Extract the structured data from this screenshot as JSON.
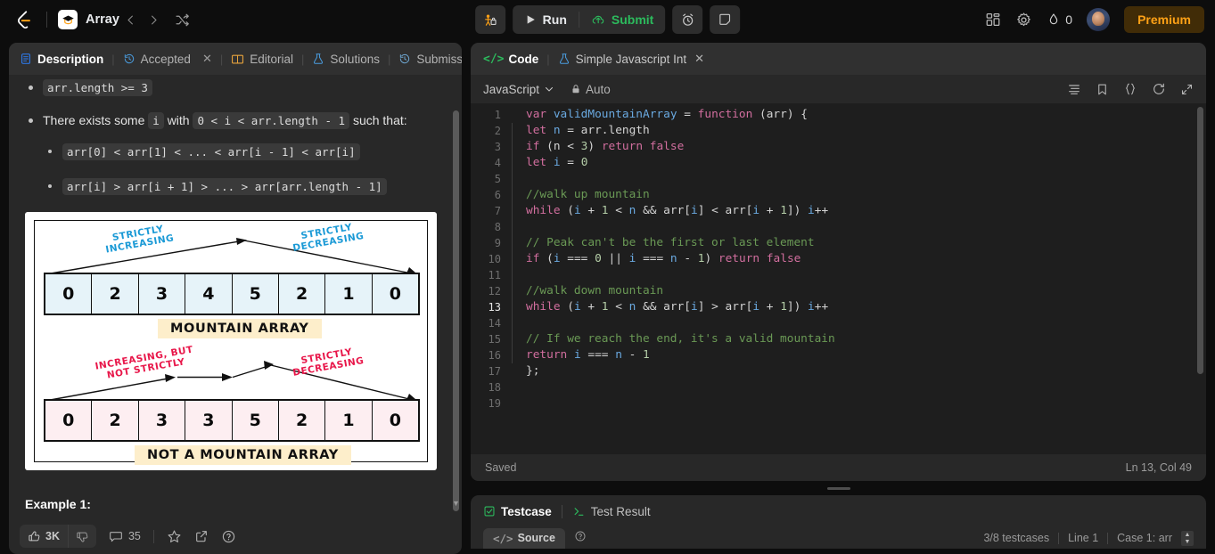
{
  "topnav": {
    "logo_icon": "leetcode-logo-icon",
    "cap_icon": "graduation-cap-icon",
    "title": "Array",
    "prev_icon": "chevron-left-icon",
    "next_icon": "chevron-right-icon",
    "shuffle_icon": "shuffle-icon",
    "debug_icon": "robot-debug-icon",
    "run_label": "Run",
    "run_icon": "play-icon",
    "submit_label": "Submit",
    "submit_icon": "cloud-upload-icon",
    "timer_icon": "alarm-clock-icon",
    "note_icon": "note-icon",
    "layout_icon": "layout-grid-icon",
    "settings_icon": "gear-icon",
    "streak_icon": "flame-icon",
    "streak_count": "0",
    "avatar_name": "user-avatar",
    "premium_label": "Premium",
    "accent_green": "#2cbb5d",
    "accent_orange": "#ffa116"
  },
  "left": {
    "tabs": [
      {
        "label": "Description",
        "icon": "document-icon",
        "active": true
      },
      {
        "label": "Accepted",
        "icon": "history-icon",
        "active": false,
        "closable": true
      },
      {
        "label": "Editorial",
        "icon": "book-icon",
        "active": false
      },
      {
        "label": "Solutions",
        "icon": "flask-icon",
        "active": false
      },
      {
        "label": "Submissi",
        "icon": "history-icon",
        "active": false
      }
    ],
    "close_label": "✕",
    "constraints": [
      {
        "code": "arr.length >= 3"
      }
    ],
    "exists_prefix": "There exists some",
    "exists_i": "i",
    "exists_mid": "with",
    "exists_range": "0 < i < arr.length - 1",
    "exists_suffix": "such that:",
    "sub_conditions": [
      "arr[0] < arr[1] < ... < arr[i - 1] < arr[i]",
      "arr[i] > arr[i + 1] > ... > arr[arr.length - 1]"
    ],
    "example_heading": "Example 1:"
  },
  "figure": {
    "mountain": {
      "cells": [
        "0",
        "2",
        "3",
        "4",
        "5",
        "2",
        "1",
        "0"
      ],
      "caption": "MOUNTAIN ARRAY",
      "label_left": "STRICTLY\nINCREASING",
      "label_right": "STRICTLY\nDECREASING",
      "cell_color": "#e6f3f9",
      "label_color": "#1b9ad6"
    },
    "not_mountain": {
      "cells": [
        "0",
        "2",
        "3",
        "3",
        "5",
        "2",
        "1",
        "0"
      ],
      "caption": "NOT A MOUNTAIN ARRAY",
      "label_left": "INCREASING, BUT\nNOT STRICTLY",
      "label_right": "STRICTLY\nDECREASING",
      "cell_color": "#fdeef1",
      "label_color": "#e8174a"
    },
    "caption_bg": "#fdeecb"
  },
  "footer": {
    "upvote_count": "3K",
    "upvote_icon": "thumbs-up-icon",
    "downvote_icon": "thumbs-down-icon",
    "comment_icon": "comment-icon",
    "comment_count": "35",
    "star_icon": "star-icon",
    "share_icon": "external-link-icon",
    "help_icon": "question-circle-icon"
  },
  "code": {
    "tab_label": "Code",
    "tab_icon": "code-brackets-icon",
    "tab_prefix": "</>",
    "tab2_label": "Simple Javascript Int",
    "tab2_icon": "flask-icon",
    "tab2_close": "✕",
    "language": "JavaScript",
    "language_chevron": "chevron-down-icon",
    "auto_label": "Auto",
    "lock_icon": "lock-icon",
    "toolbar_icons": [
      "format-lines-icon",
      "bookmark-icon",
      "braces-icon",
      "reset-icon",
      "expand-icon"
    ],
    "active_line": 13,
    "lines": [
      {
        "n": "1",
        "tokens": [
          [
            "kw",
            "var"
          ],
          [
            "pn",
            " "
          ],
          [
            "id",
            "validMountainArray"
          ],
          [
            "pn",
            " = "
          ],
          [
            "kw",
            "function"
          ],
          [
            "pn",
            " (arr) {"
          ]
        ],
        "indent": false
      },
      {
        "n": "2",
        "tokens": [
          [
            "kw",
            "let"
          ],
          [
            "pn",
            " "
          ],
          [
            "id",
            "n"
          ],
          [
            "pn",
            " = arr.length"
          ]
        ],
        "indent": true
      },
      {
        "n": "3",
        "tokens": [
          [
            "kw",
            "if"
          ],
          [
            "pn",
            " (n "
          ],
          [
            "pn",
            "< "
          ],
          [
            "num",
            "3"
          ],
          [
            "pn",
            ") "
          ],
          [
            "kw",
            "return"
          ],
          [
            "pn",
            " "
          ],
          [
            "kw",
            "false"
          ]
        ],
        "indent": true
      },
      {
        "n": "4",
        "tokens": [
          [
            "kw",
            "let"
          ],
          [
            "pn",
            " "
          ],
          [
            "id",
            "i"
          ],
          [
            "pn",
            " = "
          ],
          [
            "num",
            "0"
          ]
        ],
        "indent": true
      },
      {
        "n": "5",
        "tokens": [],
        "indent": true
      },
      {
        "n": "6",
        "tokens": [
          [
            "cm",
            "//walk up mountain"
          ]
        ],
        "indent": true
      },
      {
        "n": "7",
        "tokens": [
          [
            "kw",
            "while"
          ],
          [
            "pn",
            " ("
          ],
          [
            "id",
            "i"
          ],
          [
            "pn",
            " + "
          ],
          [
            "num",
            "1"
          ],
          [
            "pn",
            " < "
          ],
          [
            "id",
            "n"
          ],
          [
            "pn",
            " && arr["
          ],
          [
            "id",
            "i"
          ],
          [
            "pn",
            "] < arr["
          ],
          [
            "id",
            "i"
          ],
          [
            "pn",
            " + "
          ],
          [
            "num",
            "1"
          ],
          [
            "pn",
            "]) "
          ],
          [
            "id",
            "i"
          ],
          [
            "pn",
            "++"
          ]
        ],
        "indent": true
      },
      {
        "n": "8",
        "tokens": [],
        "indent": true
      },
      {
        "n": "9",
        "tokens": [
          [
            "cm",
            "// Peak can't be the first or last element"
          ]
        ],
        "indent": true
      },
      {
        "n": "10",
        "tokens": [
          [
            "kw",
            "if"
          ],
          [
            "pn",
            " ("
          ],
          [
            "id",
            "i"
          ],
          [
            "pn",
            " === "
          ],
          [
            "num",
            "0"
          ],
          [
            "pn",
            " || "
          ],
          [
            "id",
            "i"
          ],
          [
            "pn",
            " === "
          ],
          [
            "id",
            "n"
          ],
          [
            "pn",
            " - "
          ],
          [
            "num",
            "1"
          ],
          [
            "pn",
            ") "
          ],
          [
            "kw",
            "return"
          ],
          [
            "pn",
            " "
          ],
          [
            "kw",
            "false"
          ]
        ],
        "indent": true
      },
      {
        "n": "11",
        "tokens": [],
        "indent": true
      },
      {
        "n": "12",
        "tokens": [
          [
            "cm",
            "//walk down mountain"
          ]
        ],
        "indent": true
      },
      {
        "n": "13",
        "tokens": [
          [
            "kw",
            "while"
          ],
          [
            "pn",
            " ("
          ],
          [
            "id",
            "i"
          ],
          [
            "pn",
            " + "
          ],
          [
            "num",
            "1"
          ],
          [
            "pn",
            " < "
          ],
          [
            "id",
            "n"
          ],
          [
            "pn",
            " && arr["
          ],
          [
            "id",
            "i"
          ],
          [
            "pn",
            "] > arr["
          ],
          [
            "id",
            "i"
          ],
          [
            "pn",
            " + "
          ],
          [
            "num",
            "1"
          ],
          [
            "pn",
            "]) "
          ],
          [
            "id",
            "i"
          ],
          [
            "pn",
            "++"
          ]
        ],
        "indent": true
      },
      {
        "n": "14",
        "tokens": [],
        "indent": true
      },
      {
        "n": "15",
        "tokens": [
          [
            "cm",
            "// If we reach the end, it's a valid mountain"
          ]
        ],
        "indent": true
      },
      {
        "n": "16",
        "tokens": [
          [
            "kw",
            "return"
          ],
          [
            "pn",
            " "
          ],
          [
            "id",
            "i"
          ],
          [
            "pn",
            " === "
          ],
          [
            "id",
            "n"
          ],
          [
            "pn",
            " - "
          ],
          [
            "num",
            "1"
          ]
        ],
        "indent": true
      },
      {
        "n": "17",
        "tokens": [
          [
            "pn",
            "};"
          ]
        ],
        "indent": false
      },
      {
        "n": "18",
        "tokens": [],
        "indent": false
      },
      {
        "n": "19",
        "tokens": [],
        "indent": false
      }
    ],
    "status_left": "Saved",
    "status_right": "Ln 13, Col 49"
  },
  "testcase": {
    "tab1_label": "Testcase",
    "tab1_icon": "checkbox-checked-icon",
    "tab2_label": "Test Result",
    "tab2_icon": "terminal-icon",
    "source_label": "Source",
    "source_icon": "code-brackets-icon",
    "help_icon": "question-circle-icon",
    "counter": "3/8 testcases",
    "line_info": "Line 1",
    "case_info": "Case 1: arr"
  }
}
